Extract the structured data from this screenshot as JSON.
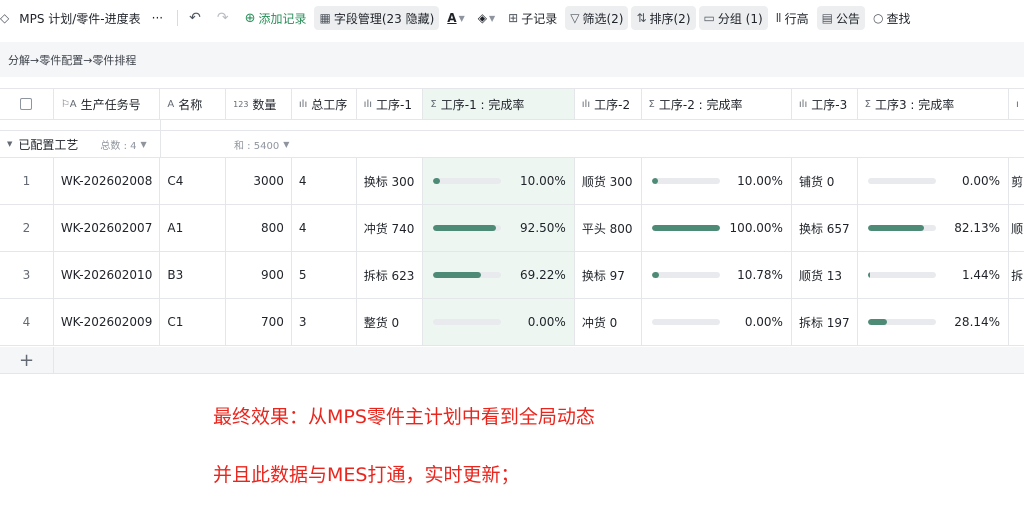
{
  "toolbar": {
    "title": "MPS 计划/零件-进度表",
    "more": "···",
    "undo": "↶",
    "redo": "↷",
    "add_record": "添加记录",
    "field_manage": "字段管理(23 隐藏)",
    "text_color": "A",
    "fill_color": "◈",
    "sub_record": "子记录",
    "filter": "筛选(2)",
    "sort": "排序(2)",
    "group": "分组 (1)",
    "row_height": "行高",
    "notice": "公告",
    "search": "查找"
  },
  "breadcrumb": "分解→零件配置→零件排程",
  "columns": [
    {
      "key": "task",
      "label": "生产任务号",
      "icon": "flag-text-icon"
    },
    {
      "key": "name",
      "label": "名称",
      "icon": "text-icon"
    },
    {
      "key": "qty",
      "label": "数量",
      "icon": "number-icon"
    },
    {
      "key": "total",
      "label": "总工序",
      "icon": "chart-icon"
    },
    {
      "key": "p1",
      "label": "工序-1",
      "icon": "chart-icon"
    },
    {
      "key": "p1r",
      "label": "工序-1 : 完成率",
      "icon": "sigma-icon"
    },
    {
      "key": "p2",
      "label": "工序-2",
      "icon": "chart-icon"
    },
    {
      "key": "p2r",
      "label": "工序-2 : 完成率",
      "icon": "sigma-icon"
    },
    {
      "key": "p3",
      "label": "工序-3",
      "icon": "chart-icon"
    },
    {
      "key": "p3r",
      "label": "工序3 : 完成率",
      "icon": "sigma-icon"
    }
  ],
  "group": {
    "label": "已配置工艺",
    "count": "总数 : 4",
    "sum": "和 : 5400"
  },
  "rows": [
    {
      "idx": "1",
      "task": "WK-202602008",
      "name": "C4",
      "qty": "3000",
      "total": "4",
      "p1": "换标 300",
      "p1r": "10.00%",
      "p1v": 0.1,
      "p2": "顺货 300",
      "p2r": "10.00%",
      "p2v": 0.1,
      "p3": "铺货 0",
      "p3r": "0.00%",
      "p3v": 0.0,
      "p4": "剪"
    },
    {
      "idx": "2",
      "task": "WK-202602007",
      "name": "A1",
      "qty": "800",
      "total": "4",
      "p1": "冲货 740",
      "p1r": "92.50%",
      "p1v": 0.925,
      "p2": "平头 800",
      "p2r": "100.00%",
      "p2v": 1.0,
      "p3": "换标 657",
      "p3r": "82.13%",
      "p3v": 0.8213,
      "p4": "顺"
    },
    {
      "idx": "3",
      "task": "WK-202602010",
      "name": "B3",
      "qty": "900",
      "total": "5",
      "p1": "拆标 623",
      "p1r": "69.22%",
      "p1v": 0.6922,
      "p2": "换标 97",
      "p2r": "10.78%",
      "p2v": 0.1078,
      "p3": "顺货 13",
      "p3r": "1.44%",
      "p3v": 0.0144,
      "p4": "拆"
    },
    {
      "idx": "4",
      "task": "WK-202602009",
      "name": "C1",
      "qty": "700",
      "total": "3",
      "p1": "整货 0",
      "p1r": "0.00%",
      "p1v": 0.0,
      "p2": "冲货 0",
      "p2r": "0.00%",
      "p2v": 0.0,
      "p3": "拆标 197",
      "p3r": "28.14%",
      "p3v": 0.2814,
      "p4": ""
    }
  ],
  "add_row": "+",
  "captions": [
    "最终效果：从MPS零件主计划中看到全局动态",
    "并且此数据与MES打通，实时更新；"
  ]
}
